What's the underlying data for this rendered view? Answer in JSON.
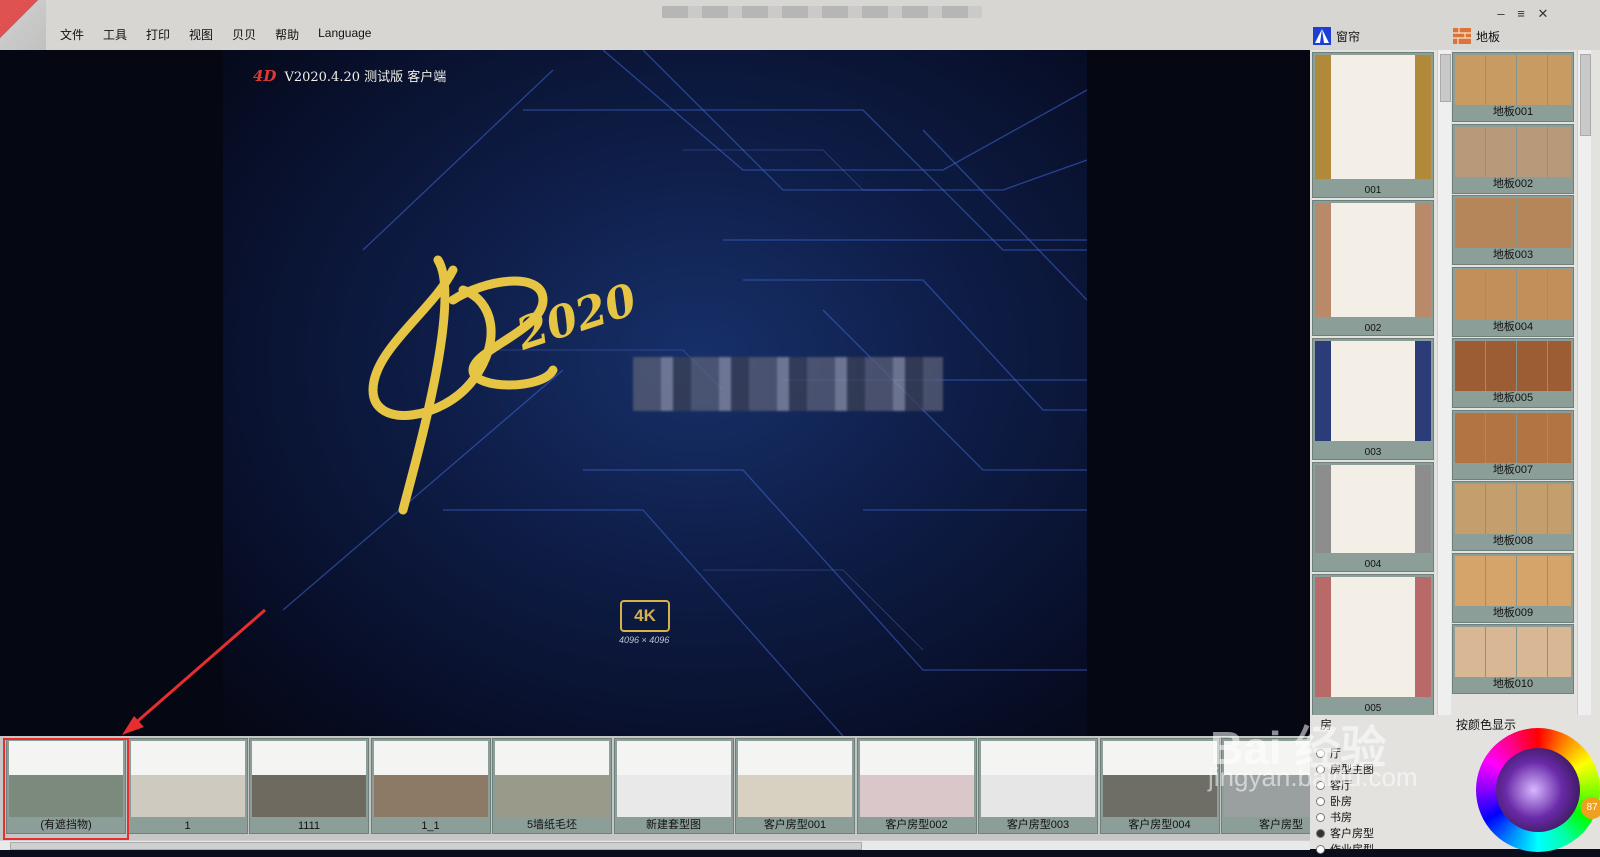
{
  "menu": [
    "文件",
    "工具",
    "打印",
    "视图",
    "贝贝",
    "帮助",
    "Language"
  ],
  "window_controls": [
    "–",
    "≡",
    "✕"
  ],
  "panels": {
    "curtain_title": "窗帘",
    "floor_title": "地板"
  },
  "splash": {
    "logo_text": "4D",
    "version": "V2020.4.20 测试版 客户端",
    "badge": "4K",
    "badge_sub": "4096 × 4096"
  },
  "curtains": [
    {
      "label": "001",
      "color": "#b08a3a"
    },
    {
      "label": "002",
      "color": "#b88a6a"
    },
    {
      "label": "003",
      "color": "#2b3c78"
    },
    {
      "label": "004",
      "color": "#8d8d8d"
    },
    {
      "label": "005",
      "color": "#b86a68"
    }
  ],
  "floors": [
    {
      "label": "地板001",
      "color": "#c89b63"
    },
    {
      "label": "地板002",
      "color": "#b89a7a"
    },
    {
      "label": "地板003",
      "color": "#b4865a"
    },
    {
      "label": "地板004",
      "color": "#c28e5a"
    },
    {
      "label": "地板005",
      "color": "#9c5d35"
    },
    {
      "label": "地板007",
      "color": "#b27443"
    },
    {
      "label": "地板008",
      "color": "#c49f6d"
    },
    {
      "label": "地板009",
      "color": "#d4a46a"
    },
    {
      "label": "地板010",
      "color": "#d8b894"
    }
  ],
  "rooms": [
    {
      "label": "(有遮挡物)",
      "color": "#7b8a7c"
    },
    {
      "label": "1",
      "color": "#cfcac0"
    },
    {
      "label": "1111",
      "color": "#6f6a5f"
    },
    {
      "label": "1_1",
      "color": "#8c7a66"
    },
    {
      "label": "5墙纸毛坯",
      "color": "#9a9a8a"
    },
    {
      "label": "新建套型图",
      "color": "#e9e9e9"
    },
    {
      "label": "客户房型001",
      "color": "#d8d0c0"
    },
    {
      "label": "客户房型002",
      "color": "#d9c7c9"
    },
    {
      "label": "客户房型003",
      "color": "#e6e6e6"
    },
    {
      "label": "客户房型004",
      "color": "#6e6d66"
    },
    {
      "label": "客户房型",
      "color": "#9aa0a0"
    }
  ],
  "room_types": {
    "header": "房",
    "items": [
      {
        "label": "厅",
        "selected": false
      },
      {
        "label": "房型主图",
        "selected": false
      },
      {
        "label": "客厅",
        "selected": false
      },
      {
        "label": "卧房",
        "selected": false
      },
      {
        "label": "书房",
        "selected": false
      },
      {
        "label": "客户房型",
        "selected": true
      },
      {
        "label": "作业房型",
        "selected": false
      }
    ]
  },
  "color_panel": {
    "label": "按颜色显示",
    "knob": "87"
  },
  "watermark": {
    "main": "Bai 经验",
    "sub": "jingyan.baidu.com"
  }
}
